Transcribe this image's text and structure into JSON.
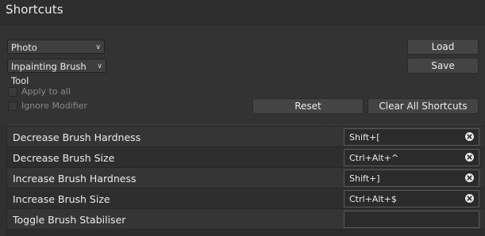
{
  "title": "Shortcuts",
  "category_select": {
    "value": "Photo"
  },
  "tool_select": {
    "value": "Inpainting Brush Tool"
  },
  "buttons": {
    "load": "Load",
    "save": "Save",
    "reset": "Reset",
    "clear_all": "Clear All Shortcuts"
  },
  "options": {
    "apply_to_all": {
      "label": "Apply to all",
      "checked": false
    },
    "ignore_modifier": {
      "label": "Ignore Modifier",
      "checked": false
    }
  },
  "shortcuts": [
    {
      "name": "Decrease Brush Hardness",
      "key": "Shift+["
    },
    {
      "name": "Decrease Brush Size",
      "key": "Ctrl+Alt+^"
    },
    {
      "name": "Increase Brush Hardness",
      "key": "Shift+]"
    },
    {
      "name": "Increase Brush Size",
      "key": "Ctrl+Alt+$"
    },
    {
      "name": "Toggle Brush Stabiliser",
      "key": ""
    }
  ],
  "icons": {
    "dropdown": "chevron-down-icon",
    "clear": "clear-circle-x-icon"
  }
}
